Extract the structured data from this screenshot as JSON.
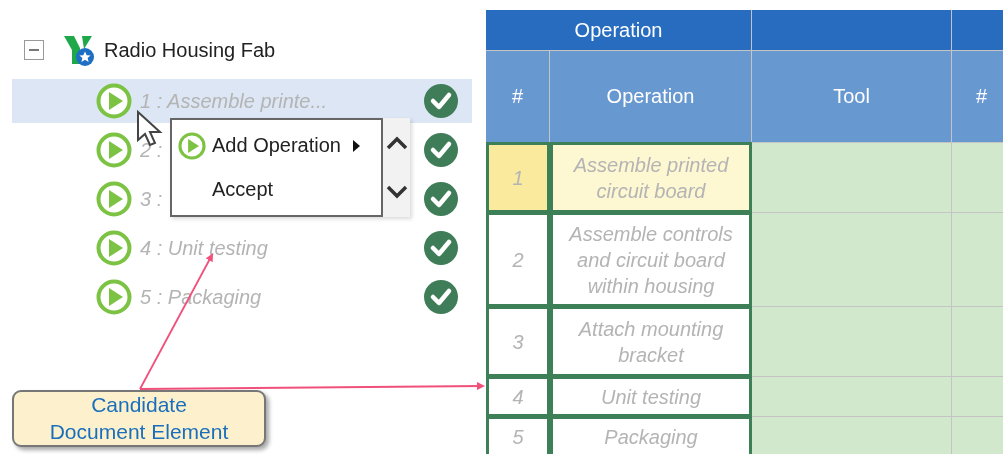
{
  "tree": {
    "root": {
      "label": "Radio Housing Fab",
      "expanded": true
    },
    "items": [
      {
        "label": "1 : Assemble printe...",
        "selected": true,
        "complete": true
      },
      {
        "label": "2 :",
        "selected": false,
        "complete": true
      },
      {
        "label": "3 :",
        "selected": false,
        "complete": true
      },
      {
        "label": "4 : Unit testing",
        "selected": false,
        "complete": true
      },
      {
        "label": "5 : Packaging",
        "selected": false,
        "complete": true
      }
    ]
  },
  "context_menu": {
    "items": [
      {
        "label": "Add Operation",
        "kind": "submenu"
      },
      {
        "label": "Accept",
        "kind": "plain"
      }
    ]
  },
  "table": {
    "group_header": "Operation",
    "columns": [
      "#",
      "Operation",
      "Tool",
      "#"
    ],
    "rows": [
      {
        "number": "1",
        "operation": "Assemble printed circuit board",
        "selected": true
      },
      {
        "number": "2",
        "operation": "Assemble controls and circuit board within housing",
        "selected": false
      },
      {
        "number": "3",
        "operation": "Attach mounting bracket",
        "selected": false
      },
      {
        "number": "4",
        "operation": "Unit testing",
        "selected": false
      },
      {
        "number": "5",
        "operation": "Packaging",
        "selected": false
      }
    ]
  },
  "callout": {
    "text": "Candidate\nDocument Element"
  }
}
